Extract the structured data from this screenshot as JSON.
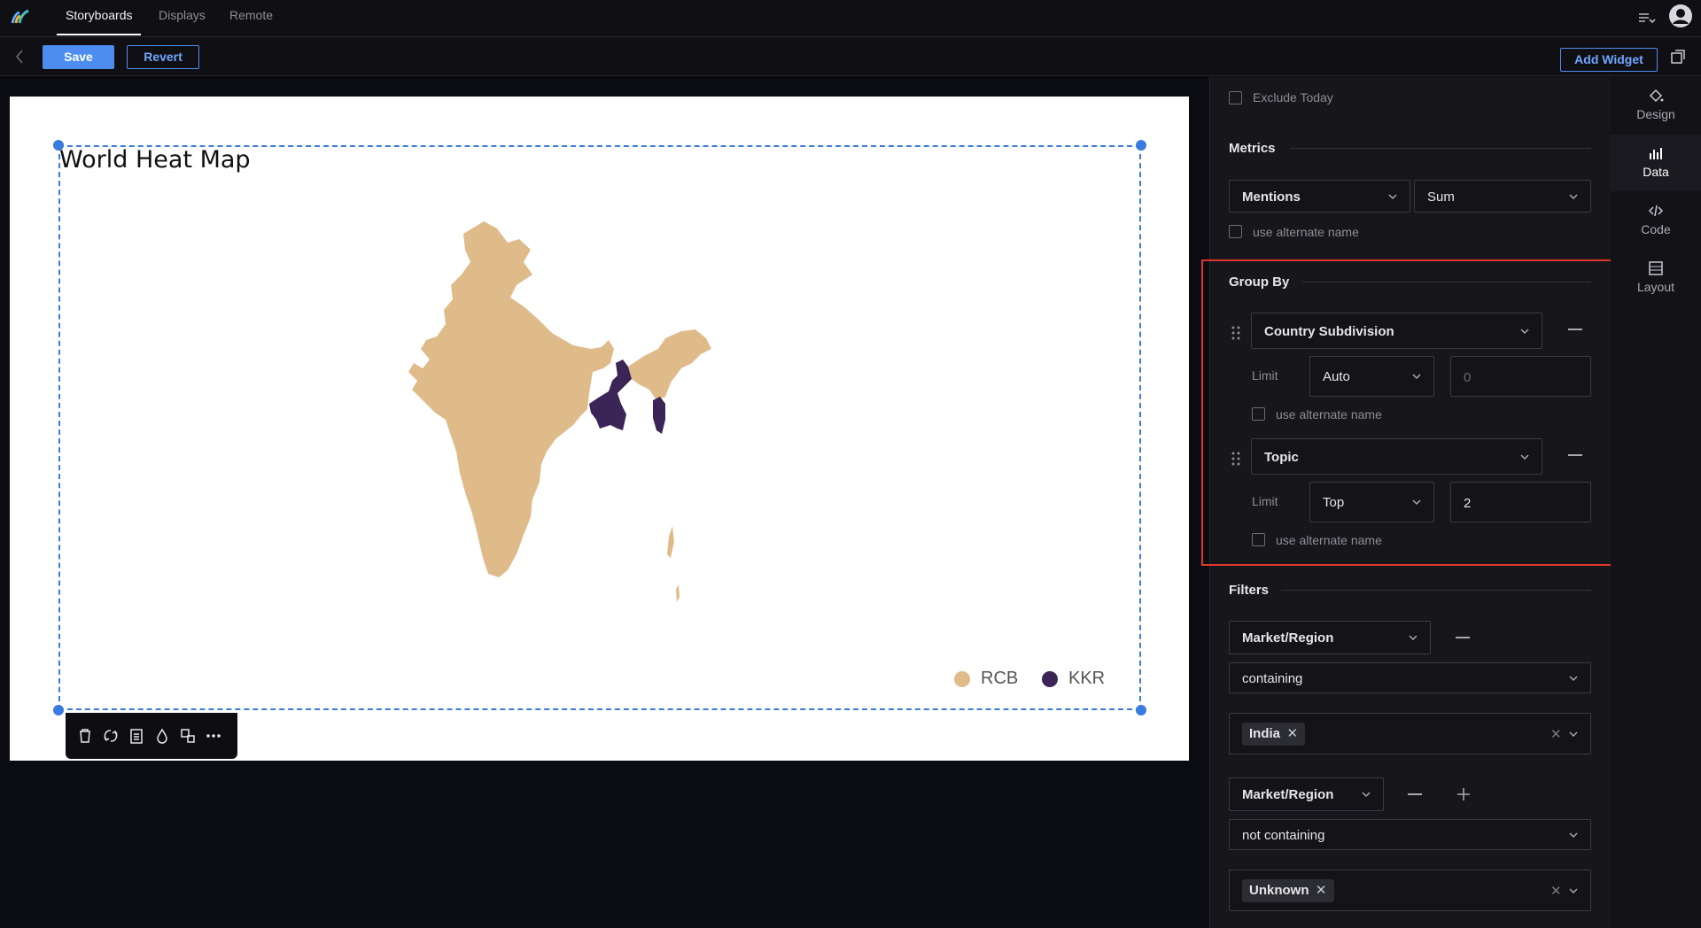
{
  "nav": {
    "tabs": [
      {
        "label": "Storyboards",
        "active": true
      },
      {
        "label": "Displays",
        "active": false
      },
      {
        "label": "Remote",
        "active": false
      }
    ]
  },
  "toolbar": {
    "save_label": "Save",
    "revert_label": "Revert",
    "add_widget_label": "Add Widget"
  },
  "widget": {
    "title": "World Heat Map",
    "legend": [
      {
        "label": "RCB",
        "color": "#e0bb8a"
      },
      {
        "label": "KKR",
        "color": "#3b2556"
      }
    ]
  },
  "panel": {
    "exclude_today_label": "Exclude Today",
    "metrics": {
      "title": "Metrics",
      "metric": "Mentions",
      "aggregation": "Sum",
      "alt_name_label": "use alternate name"
    },
    "group_by": {
      "title": "Group By",
      "limit_label": "Limit",
      "alt_name_label": "use alternate name",
      "groups": [
        {
          "field": "Country Subdivision",
          "limit_mode": "Auto",
          "limit_value": "",
          "limit_placeholder": "0"
        },
        {
          "field": "Topic",
          "limit_mode": "Top",
          "limit_value": "2",
          "limit_placeholder": ""
        }
      ]
    },
    "filters": {
      "title": "Filters",
      "items": [
        {
          "field": "Market/Region",
          "operator": "containing",
          "values": [
            "India"
          ]
        },
        {
          "field": "Market/Region",
          "operator": "not containing",
          "values": [
            "Unknown"
          ]
        }
      ]
    }
  },
  "sidebar": {
    "items": [
      {
        "label": "Design",
        "icon": "paint-bucket-icon",
        "active": false
      },
      {
        "label": "Data",
        "icon": "bar-chart-icon",
        "active": true
      },
      {
        "label": "Code",
        "icon": "code-icon",
        "active": false
      },
      {
        "label": "Layout",
        "icon": "layout-icon",
        "active": false
      }
    ]
  },
  "colors": {
    "accent": "#4d8df0",
    "highlight": "#e0372b",
    "rcb": "#e0bb8a",
    "kkr": "#3b2556"
  }
}
